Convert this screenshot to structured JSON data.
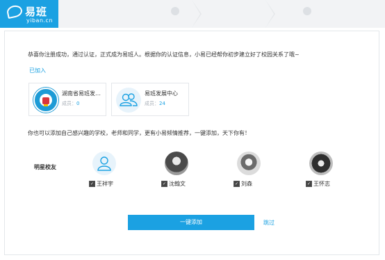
{
  "header": {
    "logo_text": "易班",
    "logo_domain": "yiban.cn",
    "steps": [
      {
        "label": ""
      },
      {
        "label": ""
      },
      {
        "label": ""
      }
    ]
  },
  "main": {
    "intro": "恭喜你注册成功，通过认证，正式成为易班人。根据你的认证信息，小易已经帮你初步建立好了校园关系了哦~",
    "joined_label": "已加入",
    "groups": [
      {
        "title": "湖南省易班发展...",
        "members_label": "成员：",
        "members": "0"
      },
      {
        "title": "易班发展中心",
        "members_label": "成员：",
        "members": "24"
      }
    ],
    "suggest_text": "你也可以添加自己感兴趣的学校，老师和同学，更有小易倾情推荐，一键添加，天下你有！",
    "section_label": "明星校友",
    "people": [
      {
        "name": "王祥宇",
        "checked": true
      },
      {
        "name": "沈翰文",
        "checked": true
      },
      {
        "name": "刘森",
        "checked": true
      },
      {
        "name": "王怀志",
        "checked": true
      }
    ],
    "add_button": "一键添加",
    "skip_link": "跳过"
  },
  "colors": {
    "accent": "#1ba1e2",
    "topbar": "#f2f3f5",
    "border": "#e3e6ea"
  }
}
